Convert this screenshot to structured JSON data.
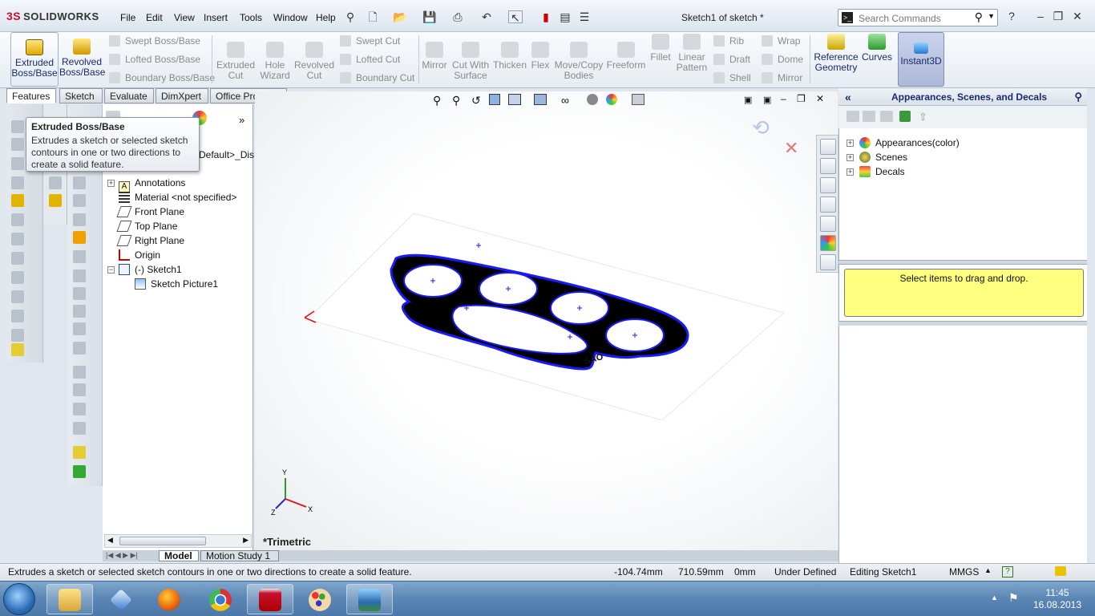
{
  "app": {
    "logo_prefix": "3S",
    "logo": "SOLIDWORKS",
    "doc_title": "Sketch1 of sketch *"
  },
  "menu": [
    "File",
    "Edit",
    "View",
    "Insert",
    "Tools",
    "Window",
    "Help"
  ],
  "search": {
    "placeholder": "Search Commands"
  },
  "ribbon": {
    "extruded_boss": "Extruded Boss/Base",
    "revolved_boss": "Revolved Boss/Base",
    "swept_boss": "Swept Boss/Base",
    "lofted_boss": "Lofted Boss/Base",
    "boundary_boss": "Boundary Boss/Base",
    "extruded_cut": "Extruded Cut",
    "hole_wizard": "Hole Wizard",
    "revolved_cut": "Revolved Cut",
    "swept_cut": "Swept Cut",
    "lofted_cut": "Lofted Cut",
    "boundary_cut": "Boundary Cut",
    "mirror": "Mirror",
    "cut_with_surface": "Cut With Surface",
    "thicken": "Thicken",
    "flex": "Flex",
    "move_copy": "Move/Copy Bodies",
    "freeform": "Freeform",
    "fillet": "Fillet",
    "linear_pattern": "Linear Pattern",
    "rib": "Rib",
    "draft": "Draft",
    "shell": "Shell",
    "wrap": "Wrap",
    "dome": "Dome",
    "mirror2": "Mirror",
    "ref_geometry": "Reference Geometry",
    "curves": "Curves",
    "instant3d": "Instant3D"
  },
  "tabs": [
    "Features",
    "Sketch",
    "Evaluate",
    "DimXpert",
    "Office Products"
  ],
  "tooltip": {
    "title": "Extruded Boss/Base",
    "desc": "Extrudes a sketch or selected sketch contours in one or two directions to create a solid feature."
  },
  "feature_tree": {
    "config_text": "Default>_Dis",
    "items": [
      "Annotations",
      "Material <not specified>",
      "Front Plane",
      "Top Plane",
      "Right Plane",
      "Origin",
      "(-) Sketch1",
      "Sketch Picture1"
    ]
  },
  "viewport": {
    "view_name": "*Trimetric",
    "axis_x": "X",
    "axis_y": "Y",
    "axis_z": "Z",
    "engraving": "SAO"
  },
  "bottom_tabs": [
    "Model",
    "Motion Study 1"
  ],
  "taskpane": {
    "title": "Appearances, Scenes, and Decals",
    "items": [
      "Appearances(color)",
      "Scenes",
      "Decals"
    ],
    "drag_hint": "Select items to drag and drop."
  },
  "status": {
    "message": "Extrudes a sketch or selected sketch contours in one or two directions to create a solid feature.",
    "x": "-104.74mm",
    "y": "710.59mm",
    "z": "0mm",
    "state": "Under Defined",
    "mode": "Editing Sketch1",
    "units": "MMGS"
  },
  "taskbar": {
    "time": "11:45",
    "date": "16.08.2013"
  },
  "colors": {
    "accent": "#1a2a6c",
    "sketch": "#1a1aff",
    "tooltip_bg": "#ffffff",
    "drag_box": "#ffff80"
  }
}
